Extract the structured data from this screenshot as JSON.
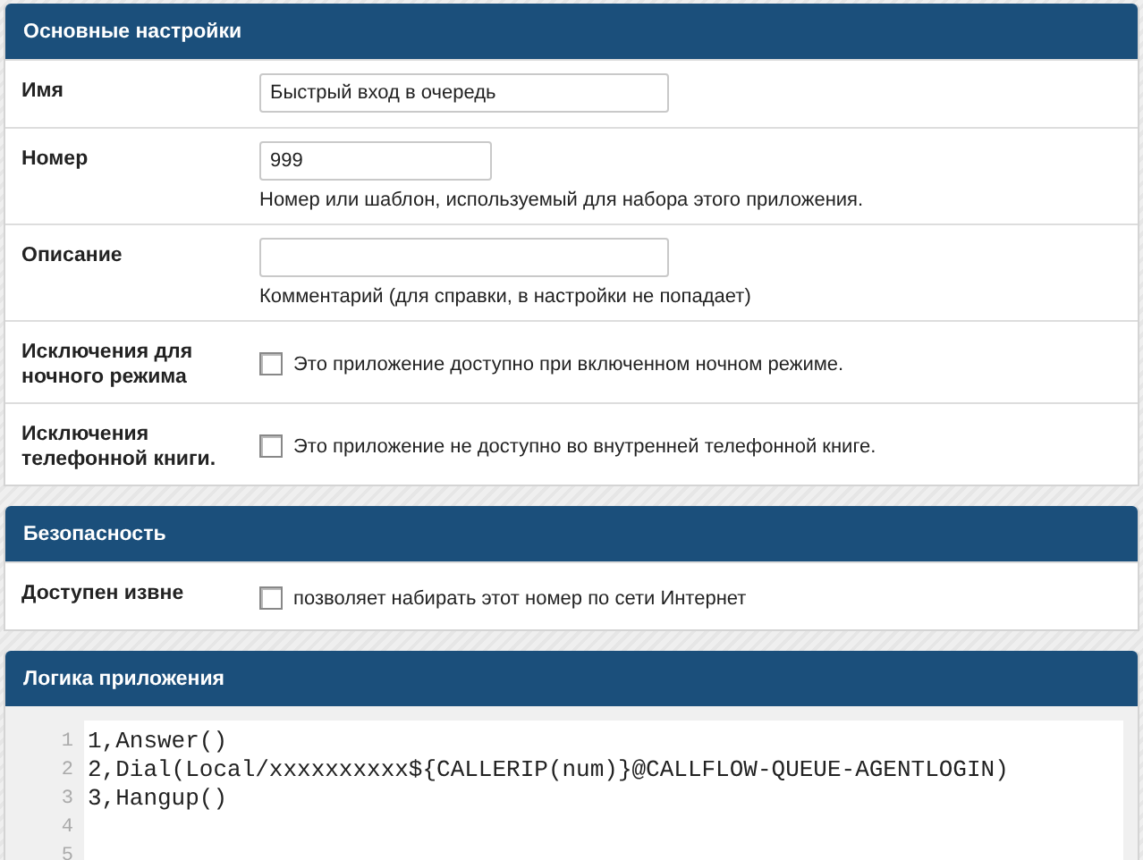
{
  "sections": [
    {
      "title": "Основные настройки",
      "rows": [
        {
          "kind": "text",
          "label": "Имя",
          "value": "Быстрый вход в очередь"
        },
        {
          "kind": "short-text",
          "label": "Номер",
          "value": "999",
          "hint": "Номер или шаблон, используемый для набора этого приложения."
        },
        {
          "kind": "text",
          "label": "Описание",
          "hint": "Комментарий (для справки, в настройки не попадает)"
        },
        {
          "kind": "checkbox",
          "label": "Исключения для ночного режима",
          "checked": false,
          "text": "Это приложение доступно при включенном ночном режиме."
        },
        {
          "kind": "checkbox",
          "label": "Исключения телефонной книги.",
          "checked": false,
          "text": "Это приложение не доступно во внутренней телефонной книге."
        }
      ]
    },
    {
      "title": "Безопасность",
      "rows": [
        {
          "kind": "checkbox",
          "label": "Доступен извне",
          "checked": false,
          "text": "позволяет набирать этот номер по сети Интернет"
        }
      ]
    },
    {
      "title": "Логика приложения",
      "code": [
        {
          "number": "1",
          "text": "1,Answer()"
        },
        {
          "number": "2",
          "text": "2,Dial(Local/xxxxxxxxxx${CALLERIP(num)}@CALLFLOW-QUEUE-AGENTLOGIN)"
        },
        {
          "number": "3",
          "text": "3,Hangup()"
        },
        {
          "number": "4"
        },
        {
          "number": "5"
        }
      ]
    }
  ]
}
